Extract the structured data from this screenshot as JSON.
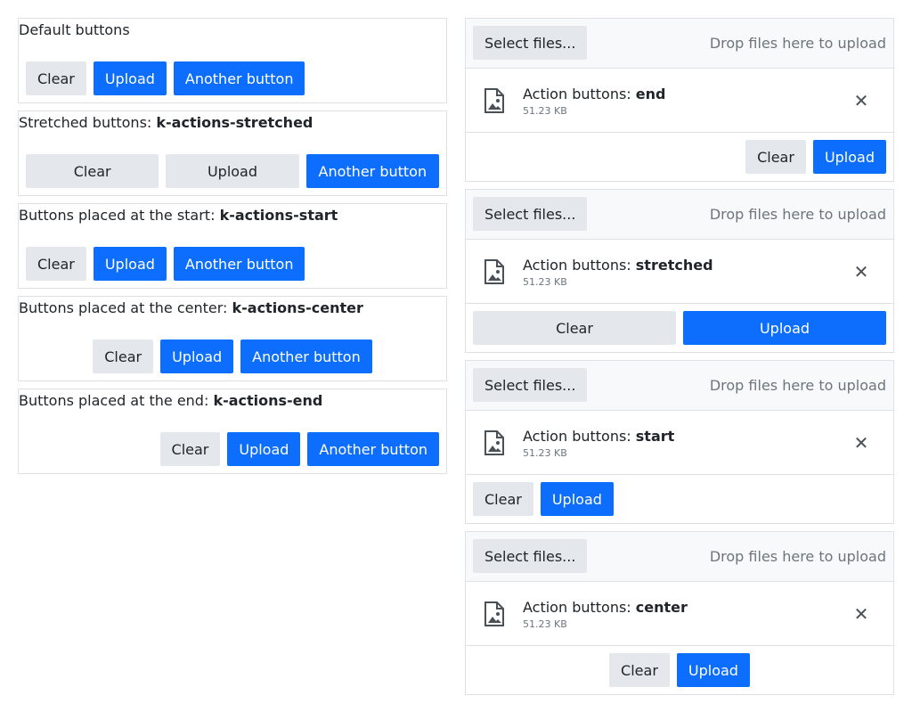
{
  "left": {
    "sections": [
      {
        "prefix": "Default buttons",
        "cls": "",
        "buttons": [
          "Clear",
          "Upload",
          "Another button"
        ]
      },
      {
        "prefix": "Stretched buttons: ",
        "cls": "k-actions-stretched",
        "buttons": [
          "Clear",
          "Upload",
          "Another button"
        ]
      },
      {
        "prefix": "Buttons placed at the start: ",
        "cls": "k-actions-start",
        "buttons": [
          "Clear",
          "Upload",
          "Another button"
        ]
      },
      {
        "prefix": "Buttons placed at the center: ",
        "cls": "k-actions-center",
        "buttons": [
          "Clear",
          "Upload",
          "Another button"
        ]
      },
      {
        "prefix": "Buttons placed at the end: ",
        "cls": "k-actions-end",
        "buttons": [
          "Clear",
          "Upload",
          "Another button"
        ]
      }
    ]
  },
  "uploads": [
    {
      "select_label": "Select files...",
      "drop_hint": "Drop files here to upload",
      "file_prefix": "Action buttons: ",
      "file_mode": "end",
      "file_size": "51.23 KB",
      "clear_label": "Clear",
      "upload_label": "Upload"
    },
    {
      "select_label": "Select files...",
      "drop_hint": "Drop files here to upload",
      "file_prefix": "Action buttons: ",
      "file_mode": "stretched",
      "file_size": "51.23 KB",
      "clear_label": "Clear",
      "upload_label": "Upload"
    },
    {
      "select_label": "Select files...",
      "drop_hint": "Drop files here to upload",
      "file_prefix": "Action buttons: ",
      "file_mode": "start",
      "file_size": "51.23 KB",
      "clear_label": "Clear",
      "upload_label": "Upload"
    },
    {
      "select_label": "Select files...",
      "drop_hint": "Drop files here to upload",
      "file_prefix": "Action buttons: ",
      "file_mode": "center",
      "file_size": "51.23 KB",
      "clear_label": "Clear",
      "upload_label": "Upload"
    }
  ],
  "colors": {
    "primary": "#0d6efd",
    "base": "#e4e7eb",
    "border": "#dee2e6",
    "muted": "#6c757d"
  }
}
